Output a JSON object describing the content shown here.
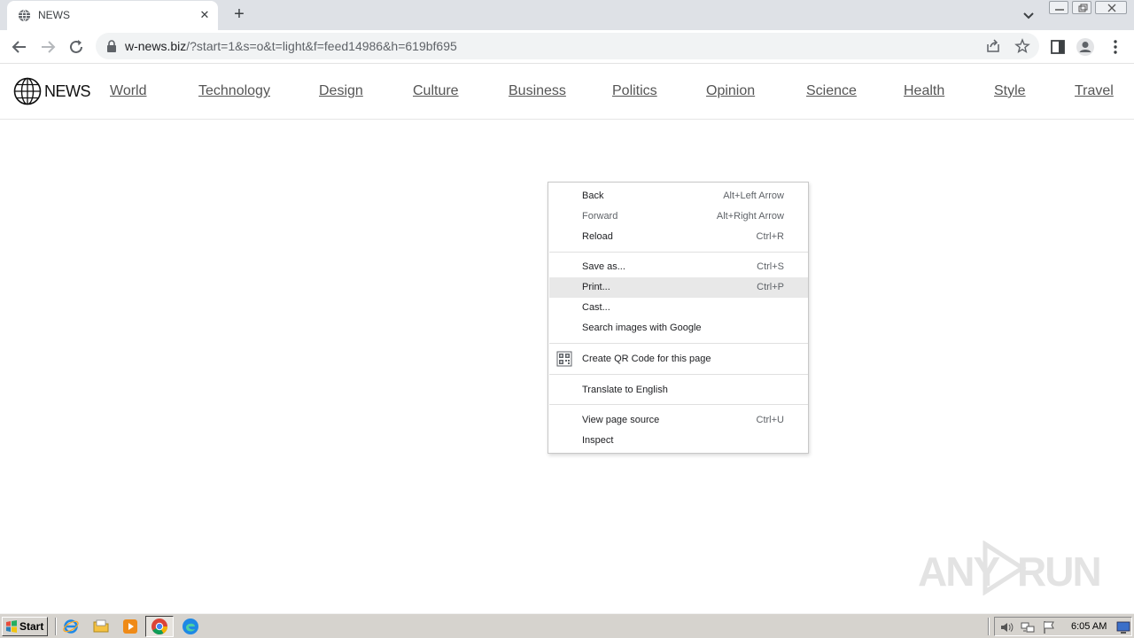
{
  "browser": {
    "tab_title": "NEWS",
    "url_host": "w-news.biz",
    "url_rest": "/?start=1&s=o&t=light&f=feed14986&h=619bf695"
  },
  "site": {
    "logo_text": "NEWS",
    "nav": [
      "World",
      "Technology",
      "Design",
      "Culture",
      "Business",
      "Politics",
      "Opinion",
      "Science",
      "Health",
      "Style",
      "Travel"
    ]
  },
  "context_menu": {
    "back": {
      "label": "Back",
      "shortcut": "Alt+Left Arrow"
    },
    "forward": {
      "label": "Forward",
      "shortcut": "Alt+Right Arrow"
    },
    "reload": {
      "label": "Reload",
      "shortcut": "Ctrl+R"
    },
    "save_as": {
      "label": "Save as...",
      "shortcut": "Ctrl+S"
    },
    "print": {
      "label": "Print...",
      "shortcut": "Ctrl+P"
    },
    "cast": {
      "label": "Cast..."
    },
    "search_images": {
      "label": "Search images with Google"
    },
    "qr_code": {
      "label": "Create QR Code for this page"
    },
    "translate": {
      "label": "Translate to English"
    },
    "view_source": {
      "label": "View page source",
      "shortcut": "Ctrl+U"
    },
    "inspect": {
      "label": "Inspect"
    }
  },
  "watermark": {
    "left": "ANY",
    "right": "RUN"
  },
  "taskbar": {
    "start_label": "Start",
    "clock": "6:05 AM"
  },
  "colors": {
    "tabstrip": "#dee1e6",
    "omnibox": "#f1f3f4",
    "menu_highlight": "#e8e8e8",
    "taskbar": "#d6d3ce"
  }
}
